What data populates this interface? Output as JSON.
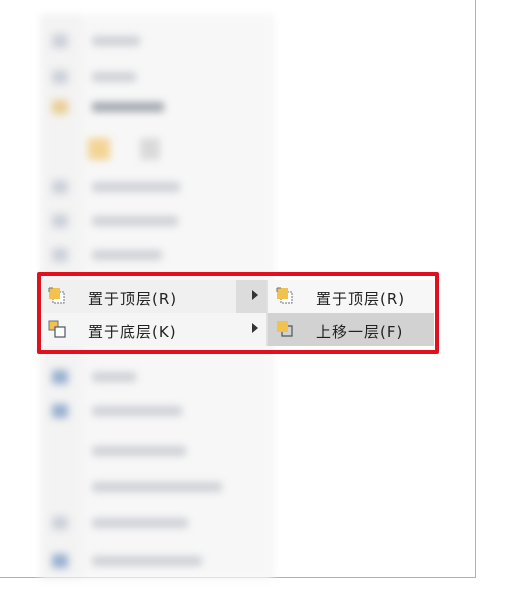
{
  "context_menu": {
    "items": [
      {
        "label": "置于顶层(R)",
        "icon": "bring-to-front-icon",
        "has_submenu": true
      },
      {
        "label": "置于底层(K)",
        "icon": "send-to-back-icon",
        "has_submenu": true
      }
    ]
  },
  "submenu": {
    "items": [
      {
        "label": "置于顶层(R)",
        "icon": "bring-to-front-icon"
      },
      {
        "label": "上移一层(F)",
        "icon": "bring-forward-icon",
        "hovered": true
      }
    ]
  },
  "colors": {
    "highlight": "#e0101e",
    "icon_fill": "#f2c14e",
    "hover": "#d2d2d2"
  }
}
